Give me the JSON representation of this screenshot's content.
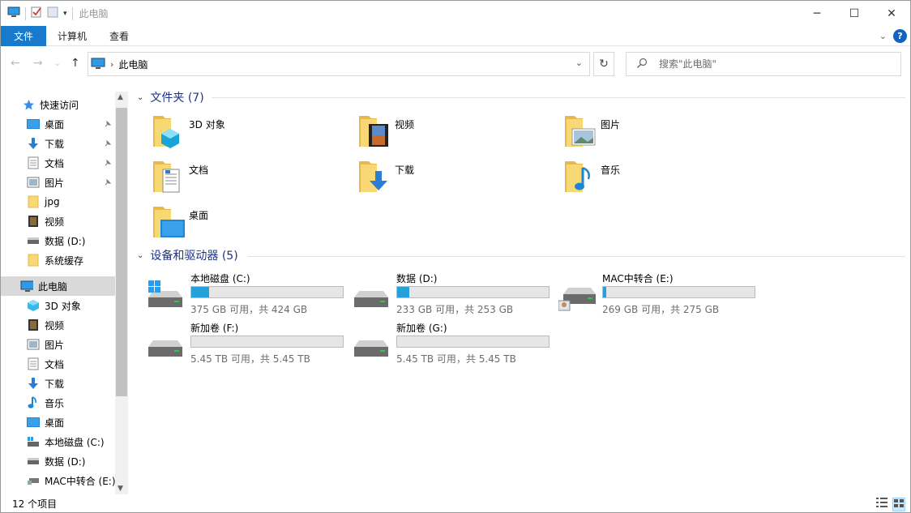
{
  "window": {
    "title": "此电脑"
  },
  "ribbon": {
    "tabs": [
      "文件",
      "计算机",
      "查看"
    ]
  },
  "address": {
    "path": "此电脑"
  },
  "search": {
    "placeholder": "搜索\"此电脑\""
  },
  "sidebar": {
    "quick_access": "快速访问",
    "quick_items": [
      "桌面",
      "下载",
      "文档",
      "图片",
      "jpg",
      "视频",
      "数据 (D:)",
      "系统缓存"
    ],
    "this_pc": "此电脑",
    "pc_items": [
      "3D 对象",
      "视频",
      "图片",
      "文档",
      "下载",
      "音乐",
      "桌面",
      "本地磁盘 (C:)",
      "数据 (D:)",
      "MAC中转合 (E:)"
    ]
  },
  "folders": {
    "header": "文件夹 (7)",
    "items": [
      "3D 对象",
      "视频",
      "图片",
      "文档",
      "下载",
      "音乐",
      "桌面"
    ]
  },
  "drives": {
    "header": "设备和驱动器 (5)",
    "items": [
      {
        "name": "本地磁盘 (C:)",
        "free": "375 GB 可用，共 424 GB",
        "used_fraction": 0.116
      },
      {
        "name": "数据 (D:)",
        "free": "233 GB 可用，共 253 GB",
        "used_fraction": 0.079
      },
      {
        "name": "MAC中转合 (E:)",
        "free": "269 GB 可用，共 275 GB",
        "used_fraction": 0.022
      },
      {
        "name": "新加卷 (F:)",
        "free": "5.45 TB 可用，共 5.45 TB",
        "used_fraction": 0.0
      },
      {
        "name": "新加卷 (G:)",
        "free": "5.45 TB 可用，共 5.45 TB",
        "used_fraction": 0.0
      }
    ]
  },
  "status": {
    "count": "12 个项目"
  },
  "colors": {
    "accent": "#1979ca",
    "header": "#1e3287",
    "bar_fill": "#26a0da",
    "folder": "#f8d775"
  }
}
